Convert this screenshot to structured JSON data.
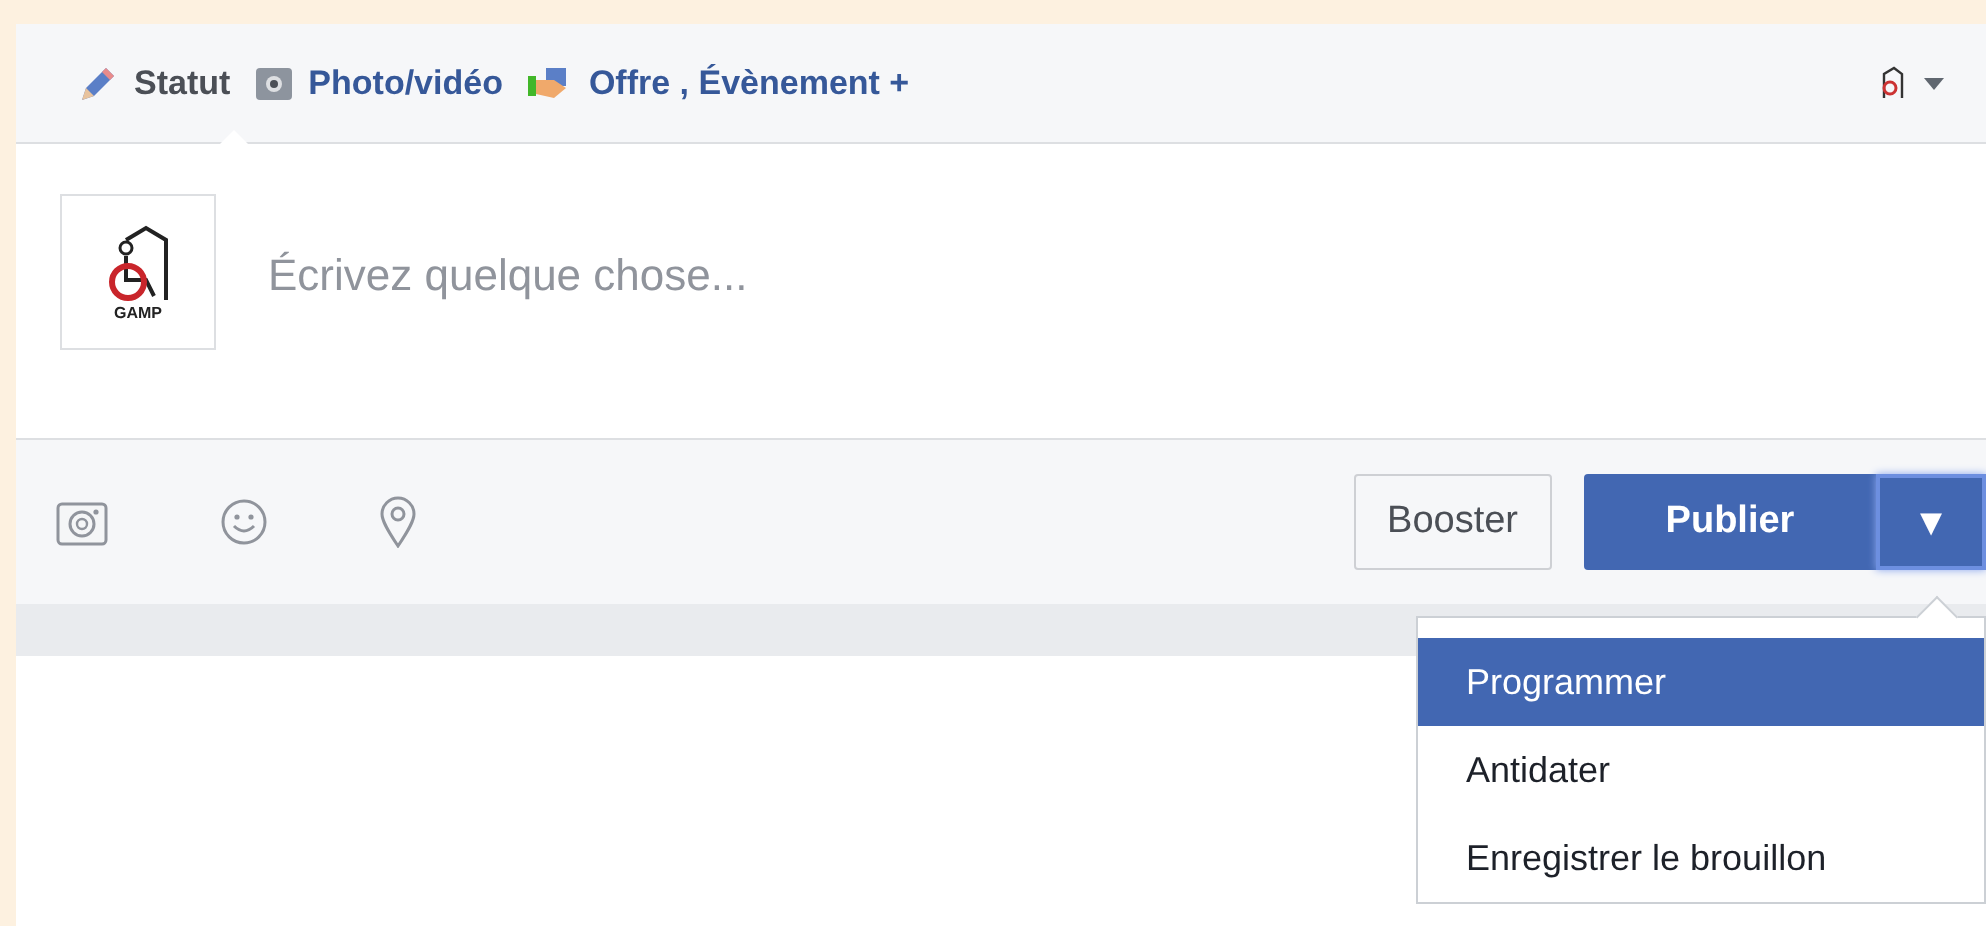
{
  "tabs": [
    {
      "label": "Statut",
      "kind": "pencil",
      "selected": true
    },
    {
      "label": "Photo/vidéo",
      "kind": "camera",
      "selected": false
    },
    {
      "label": "Offre , Évènement +",
      "kind": "offer",
      "selected": false
    }
  ],
  "composer": {
    "logo_text": "GAMP",
    "placeholder": "Écrivez quelque chose..."
  },
  "actions": {
    "booster": "Booster",
    "publish": "Publier",
    "menu_arrow": "▾"
  },
  "menu": [
    {
      "label": "Programmer",
      "selected": true
    },
    {
      "label": "Antidater",
      "selected": false
    },
    {
      "label": "Enregistrer le brouillon",
      "selected": false
    }
  ]
}
